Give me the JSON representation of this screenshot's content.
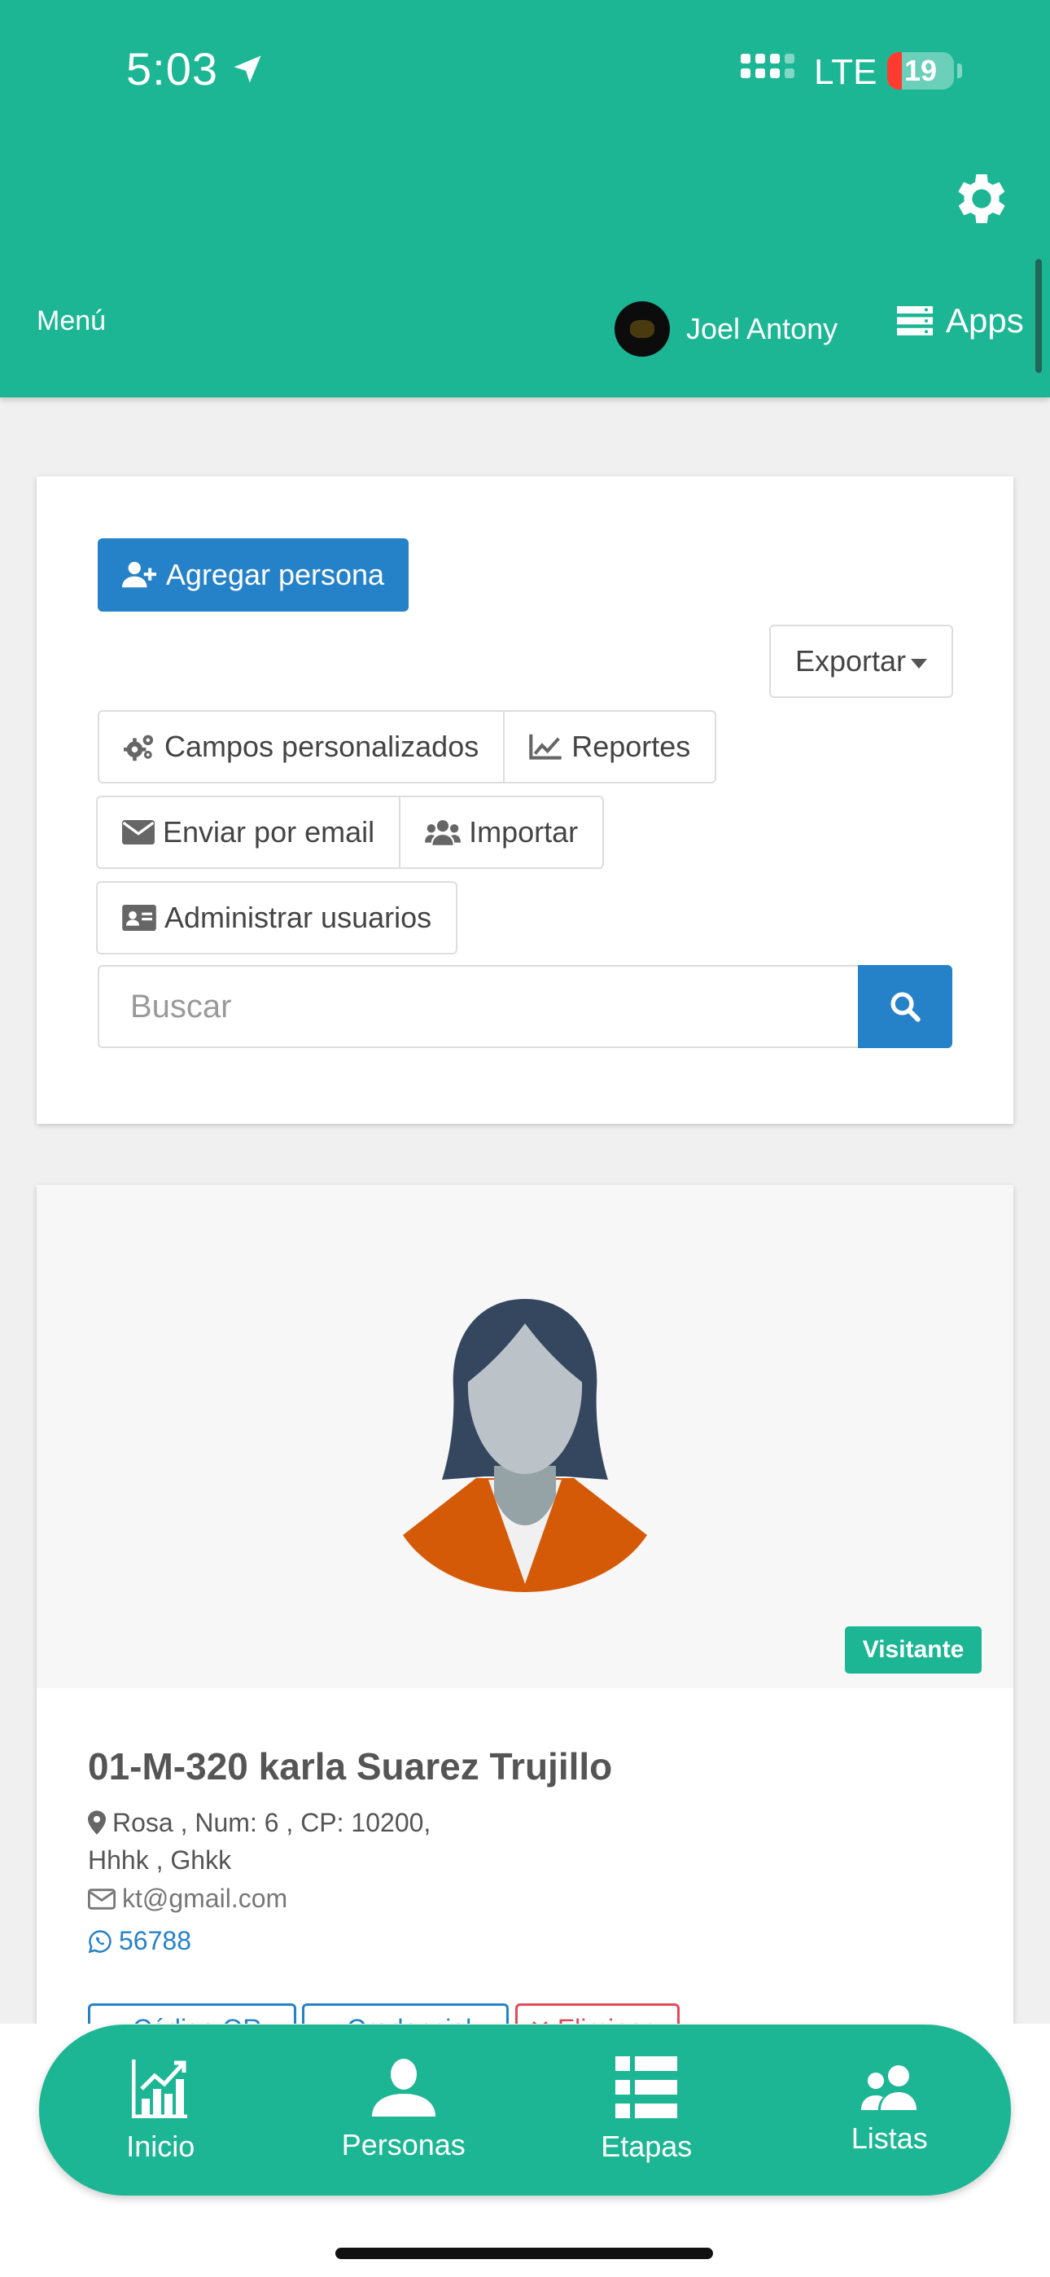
{
  "status_bar": {
    "time": "5:03",
    "network": "LTE",
    "battery": "19"
  },
  "header": {
    "menu_label": "Menú",
    "user_name": "Joel Antony",
    "apps_label": "Apps"
  },
  "toolbar": {
    "add_person": "Agregar persona",
    "export": "Exportar",
    "custom_fields": "Campos personalizados",
    "reports": "Reportes",
    "send_email": "Enviar por email",
    "import": "Importar",
    "manage_users": "Administrar usuarios",
    "search_placeholder": "Buscar"
  },
  "person": {
    "badge": "Visitante",
    "name": "01-M-320 karla Suarez Trujillo",
    "address_line1": "Rosa , Num: 6 , CP: 10200,",
    "address_line2": "Hhhk , Ghkk",
    "email": "kt@gmail.com",
    "phone": "56788",
    "actions": [
      "Código QR",
      "Credencial",
      "Eliminar"
    ]
  },
  "tabs": [
    {
      "label": "Inicio",
      "icon": "chart-icon"
    },
    {
      "label": "Personas",
      "icon": "person-icon"
    },
    {
      "label": "Etapas",
      "icon": "list-icon"
    },
    {
      "label": "Listas",
      "icon": "group-icon"
    }
  ],
  "colors": {
    "brand": "#1cb694",
    "primary": "#2682c8",
    "danger": "#e04a5a"
  }
}
